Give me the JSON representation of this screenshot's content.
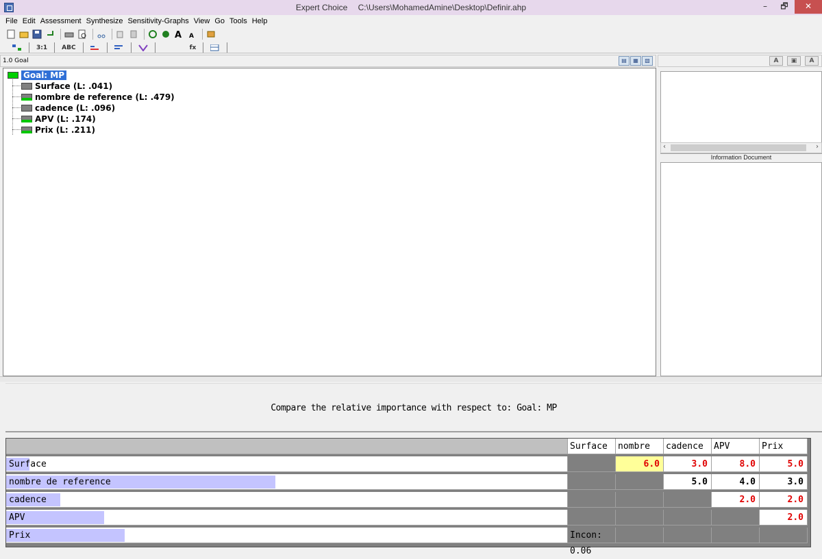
{
  "window": {
    "app_name": "Expert Choice",
    "file_path": "C:\\Users\\MohamedAmine\\Desktop\\Definir.ahp",
    "min_glyph": "–",
    "max_glyph": "🗗",
    "close_glyph": "✕"
  },
  "menu": [
    "File",
    "Edit",
    "Assessment",
    "Synthesize",
    "Sensitivity-Graphs",
    "View",
    "Go",
    "Tools",
    "Help"
  ],
  "tabs": [
    "3:1",
    "ABC",
    "",
    "",
    "",
    "fx",
    ""
  ],
  "tree": {
    "header": "1.0 Goal",
    "goal": "Goal: MP",
    "children": [
      {
        "label": "Surface (L: .041)",
        "marker": "grey"
      },
      {
        "label": "nombre de reference (L: .479)",
        "marker": "green"
      },
      {
        "label": "cadence (L: .096)",
        "marker": "grey"
      },
      {
        "label": "APV (L: .174)",
        "marker": "green"
      },
      {
        "label": "Prix (L: .211)",
        "marker": "green"
      }
    ]
  },
  "right_panel": {
    "info_label": "Information Document"
  },
  "compare": {
    "prompt": "Compare the relative importance with respect to: Goal: MP"
  },
  "matrix": {
    "columns": [
      "Surface",
      "nombre de",
      "cadence",
      "APV",
      "Prix"
    ],
    "rows": [
      {
        "label": "Surface",
        "priority_bar": 0.041
      },
      {
        "label": "nombre de reference",
        "priority_bar": 0.479
      },
      {
        "label": "cadence",
        "priority_bar": 0.096
      },
      {
        "label": "APV",
        "priority_bar": 0.174
      },
      {
        "label": "Prix",
        "priority_bar": 0.211
      }
    ],
    "cells": {
      "r0c1": "6.0",
      "r0c2": "3.0",
      "r0c3": "8.0",
      "r0c4": "5.0",
      "r1c2": "5.0",
      "r1c3": "4.0",
      "r1c4": "3.0",
      "r2c3": "2.0",
      "r2c4": "2.0",
      "r3c4": "2.0"
    },
    "inconsistency": "Incon: 0.06",
    "red_color": "#e00000",
    "bar_color": "#c4c4ff"
  }
}
